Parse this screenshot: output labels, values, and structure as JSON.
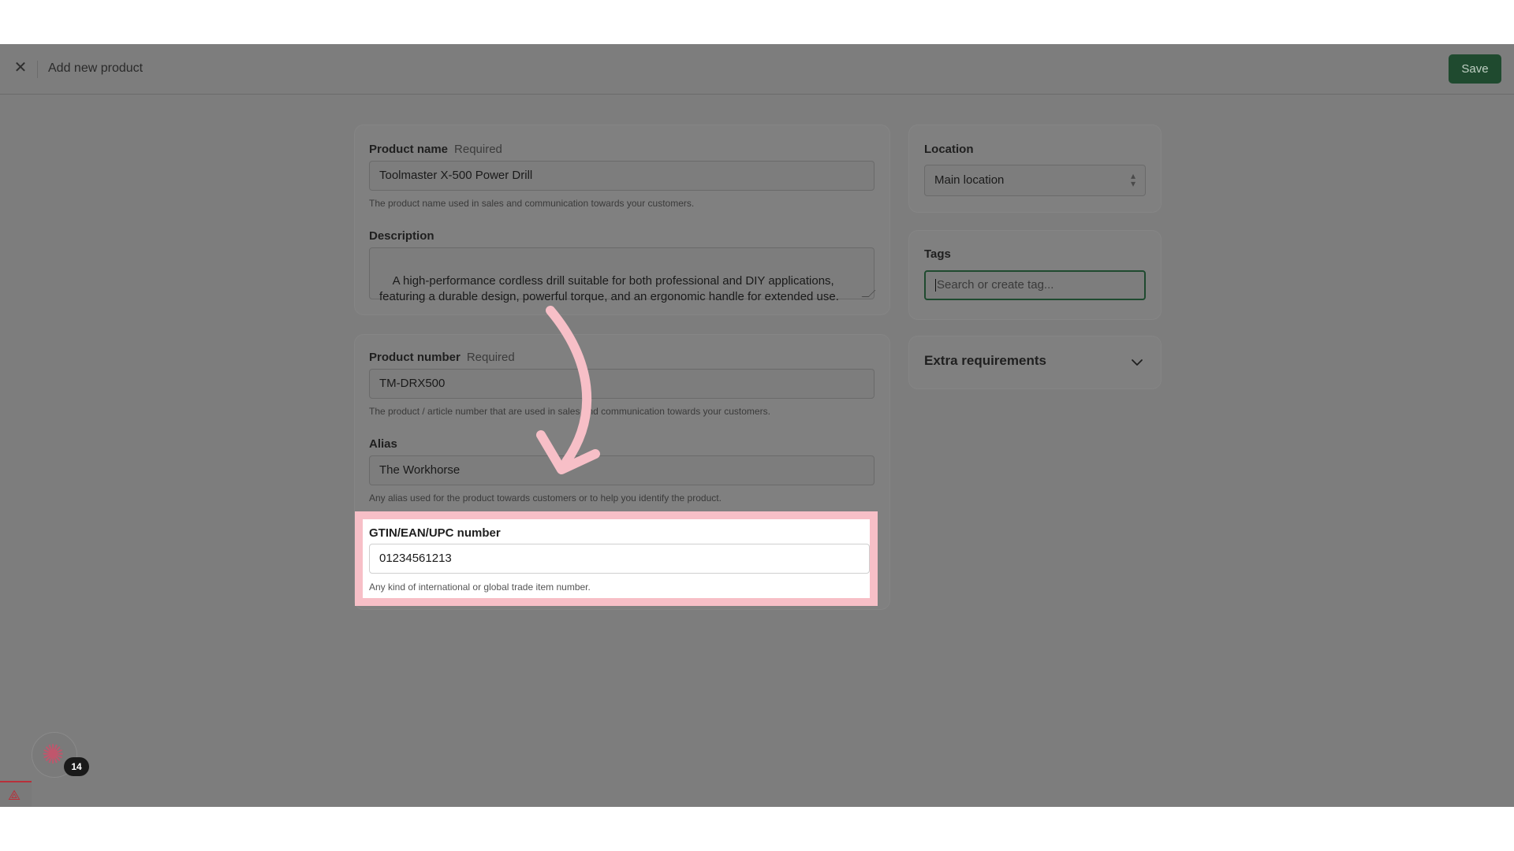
{
  "header": {
    "close_icon": "✕",
    "title": "Add new product",
    "save_label": "Save",
    "accent_color": "#1f4a2f"
  },
  "main": {
    "product_name": {
      "label": "Product name",
      "required": "Required",
      "value": "Toolmaster X-500 Power Drill",
      "help": "The product name used in sales and communication towards your customers."
    },
    "description": {
      "label": "Description",
      "value": "A high-performance cordless drill suitable for both professional and DIY applications,\nfeaturing a durable design, powerful torque, and an ergonomic handle for extended use."
    },
    "product_number": {
      "label": "Product number",
      "required": "Required",
      "value": "TM-DRX500",
      "help": "The product / article number that are used in sales and communication towards your customers."
    },
    "alias": {
      "label": "Alias",
      "value": "The Workhorse",
      "help": "Any alias used for the product towards customers or to help you identify the product."
    },
    "gtin": {
      "label": "GTIN/EAN/UPC number",
      "value": "01234561213",
      "help": "Any kind of international or global trade item number.",
      "highlight_color": "#f7bfc7"
    }
  },
  "sidebar": {
    "location": {
      "label": "Location",
      "selected": "Main location",
      "chevron_icon": "⌃⌄"
    },
    "tags": {
      "label": "Tags",
      "placeholder": "Search or create tag..."
    },
    "extra": {
      "label": "Extra requirements",
      "chevron_icon": "⌄"
    }
  },
  "widgets": {
    "notification_count": "14",
    "fab_icon": "✺",
    "laravel_icon": "⟁"
  }
}
